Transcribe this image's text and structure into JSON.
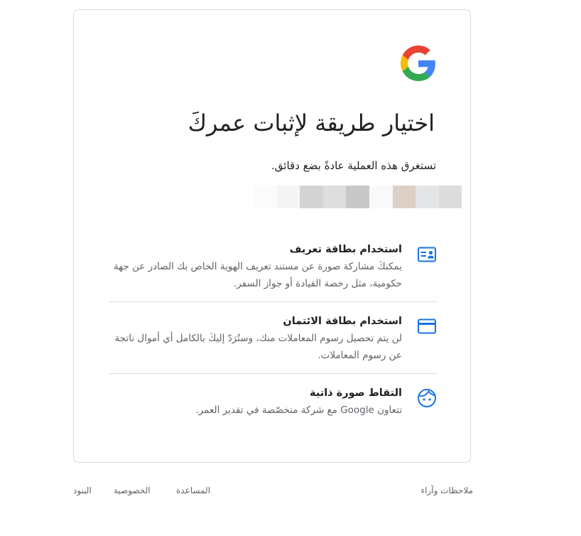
{
  "title": "اختيار طريقة لإثبات عمركَ",
  "subtitle": "تستغرق هذه العملية عادةً بضع دقائق.",
  "blurred_account_colors": [
    "#fbfbfb",
    "#f5f5f5",
    "#d3d3d3",
    "#dedede",
    "#c8c8c8",
    "#f9f9f9",
    "#dcd0c6",
    "#e4e5e7",
    "#dcdcdc"
  ],
  "options": [
    {
      "title": "استخدام بطاقة تعريف",
      "description": "يمكنكَ مشاركة صورة عن مستند تعريف الهوية الخاص بك الصادر عن جهة حكومية، مثل رخصة القيادة أو جواز السفر.",
      "icon": "id-card-icon"
    },
    {
      "title": "استخدام بطاقة الائتمان",
      "description": "لن يتم تحصيل رسوم المعاملات منك، وستُرَدّ إليكَ بالكامل أي أموال ناتجة عن رسوم المعاملات.",
      "icon": "credit-card-icon"
    },
    {
      "title": "التقاط صورة ذاتية",
      "description": "تتعاون Google مع شركة متخصّصة في تقدير العمر.",
      "icon": "face-icon"
    }
  ],
  "footer": {
    "feedback": "ملاحظات وآراء",
    "help": "المساعدة",
    "privacy": "الخصوصية",
    "terms": "البنود"
  },
  "colors": {
    "accent": "#1a73e8",
    "text": "#202124",
    "secondary": "#5f6368",
    "border": "#dadce0"
  }
}
